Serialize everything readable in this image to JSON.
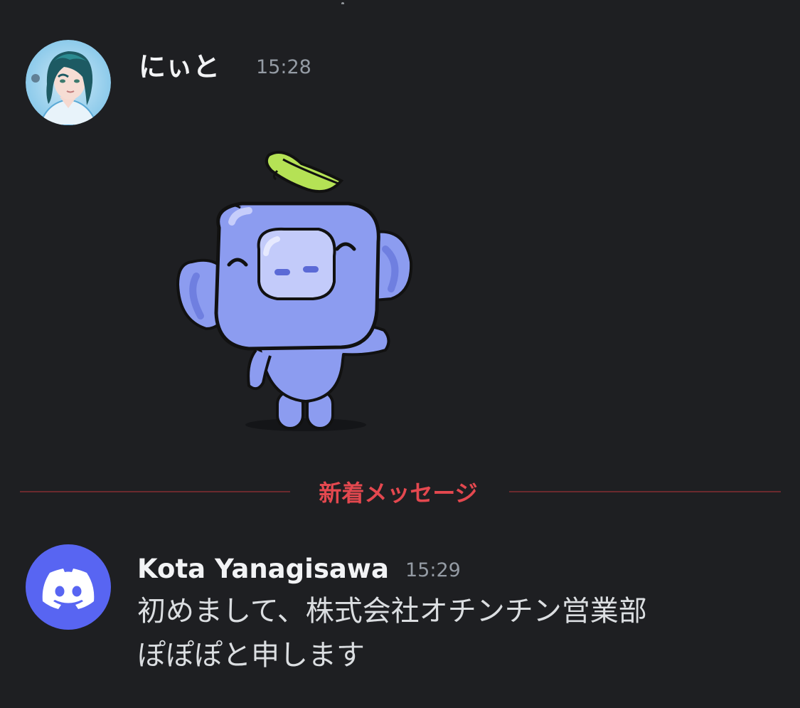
{
  "messages": [
    {
      "username": "にぃと",
      "timestamp": "15:28",
      "avatar": "anime-character-avatar",
      "attachment": "wumpus-sticker"
    },
    {
      "username": "Kota Yanagisawa",
      "timestamp": "15:29",
      "avatar": "discord-logo-icon",
      "text_lines": [
        "初めまして、株式会社オチンチン営業部",
        "ぽぽぽと申します"
      ]
    }
  ],
  "divider": {
    "label": "新着メッセージ",
    "color": "#e4484f"
  },
  "colors": {
    "background": "#1e1f22",
    "blurple": "#5865f2",
    "timestamp": "#949ba4"
  }
}
